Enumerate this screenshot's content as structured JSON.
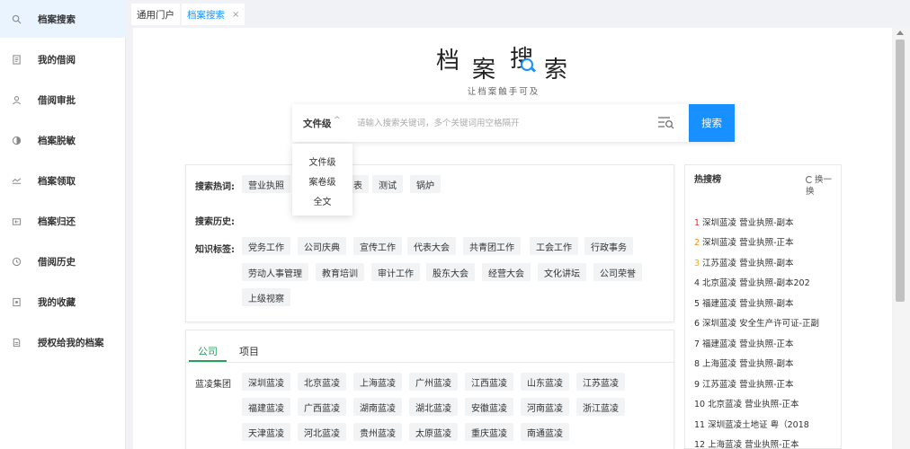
{
  "sidebar": {
    "items": [
      {
        "label": "档案搜索",
        "icon": "search-icon"
      },
      {
        "label": "我的借阅",
        "icon": "document-icon"
      },
      {
        "label": "借阅审批",
        "icon": "user-check-icon"
      },
      {
        "label": "档案脱敏",
        "icon": "contrast-icon"
      },
      {
        "label": "档案领取",
        "icon": "receive-icon"
      },
      {
        "label": "档案归还",
        "icon": "return-icon"
      },
      {
        "label": "借阅历史",
        "icon": "history-icon"
      },
      {
        "label": "我的收藏",
        "icon": "favorite-icon"
      },
      {
        "label": "授权给我的档案",
        "icon": "authorized-doc-icon"
      }
    ]
  },
  "tabs": [
    {
      "label": "通用门户"
    },
    {
      "label": "档案搜索",
      "close": "×"
    }
  ],
  "logo": {
    "chars": [
      "档",
      "案",
      "搜",
      "索"
    ]
  },
  "subtitle": "让档案触手可及",
  "search": {
    "level": "文件级",
    "caret": "^",
    "placeholder": "请输入搜索关键词，多个关键词用空格隔开",
    "button": "搜索"
  },
  "dropdown": {
    "options": [
      "文件级",
      "案卷级",
      "全文"
    ]
  },
  "hot_terms": {
    "label": "搜索热词:",
    "tags": [
      "营业执照",
      "表",
      "测试",
      "锅炉"
    ]
  },
  "history": {
    "label": "搜索历史:"
  },
  "knowledge": {
    "label": "知识标签:",
    "tags": [
      "党务工作",
      "公司庆典",
      "宣传工作",
      "代表大会",
      "共青团工作",
      "工会工作",
      "行政事务",
      "劳动人事管理",
      "教育培训",
      "审计工作",
      "股东大会",
      "经营大会",
      "文化讲坛",
      "公司荣誉",
      "上级视察"
    ]
  },
  "company_tabs": [
    "公司",
    "项目"
  ],
  "group": {
    "label": "蓝凌集团",
    "companies": [
      "深圳蓝凌",
      "北京蓝凌",
      "上海蓝凌",
      "广州蓝凌",
      "江西蓝凌",
      "山东蓝凌",
      "江苏蓝凌",
      "福建蓝凌",
      "广西蓝凌",
      "湖南蓝凌",
      "湖北蓝凌",
      "安徽蓝凌",
      "河南蓝凌",
      "浙江蓝凌",
      "天津蓝凌",
      "河北蓝凌",
      "贵州蓝凌",
      "太原蓝凌",
      "重庆蓝凌",
      "南通蓝凌"
    ]
  },
  "hot_list": {
    "title": "热搜榜",
    "refresh": "换一换",
    "items": [
      {
        "rank": "1",
        "text": "深圳蓝凌 营业执照-副本",
        "color": "#f5222d"
      },
      {
        "rank": "2",
        "text": "深圳蓝凌 营业执照-正本",
        "color": "#fa8c16"
      },
      {
        "rank": "3",
        "text": "江苏蓝凌 营业执照-副本",
        "color": "#faad14"
      },
      {
        "rank": "4",
        "text": "北京蓝凌 营业执照-副本202",
        "color": "#333333"
      },
      {
        "rank": "5",
        "text": "福建蓝凌 营业执照-副本",
        "color": "#333333"
      },
      {
        "rank": "6",
        "text": "深圳蓝凌 安全生产许可证-正副",
        "color": "#333333"
      },
      {
        "rank": "7",
        "text": "福建蓝凌 营业执照-正本",
        "color": "#333333"
      },
      {
        "rank": "8",
        "text": "上海蓝凌 营业执照-副本",
        "color": "#333333"
      },
      {
        "rank": "9",
        "text": "江苏蓝凌 营业执照-正本",
        "color": "#333333"
      },
      {
        "rank": "10",
        "text": "北京蓝凌 营业执照-正本",
        "color": "#333333"
      },
      {
        "rank": "11",
        "text": "深圳蓝凌土地证 粤（2018",
        "color": "#333333"
      },
      {
        "rank": "12",
        "text": "上海蓝凌 营业执照-正本",
        "color": "#333333"
      }
    ]
  },
  "colors": {
    "accent": "#1890ff",
    "green": "#2a9d5c"
  }
}
